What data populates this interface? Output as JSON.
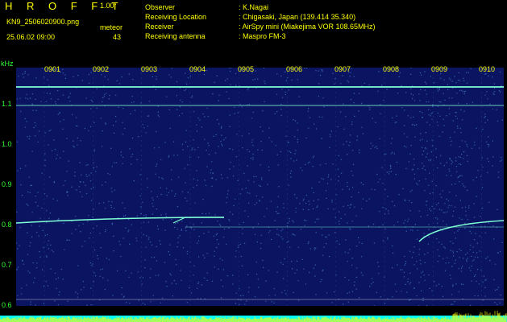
{
  "header": {
    "app_title": "H R O F F T",
    "version": "1.00f",
    "filename": "KN9_2506020900.png",
    "datetime": "25.06.02 09:00",
    "meteor_label": "meteor",
    "meteor_count": "43"
  },
  "info": [
    {
      "key": "Observer",
      "value": ": K.Nagai"
    },
    {
      "key": "Receiving Location",
      "value": ": Chigasaki, Japan (139.414 35.340)"
    },
    {
      "key": "Receiver",
      "value": ": AirSpy mini (Miakejima VOR 108.65MHz)"
    },
    {
      "key": "Receiving antenna",
      "value": ": Maspro FM-3"
    }
  ],
  "axis": {
    "unit": "kHz",
    "y_ticks": [
      "1.1",
      "1.0",
      "0.9",
      "0.8",
      "0.7",
      "0.6"
    ],
    "x_ticks": [
      "0901",
      "0902",
      "0903",
      "0904",
      "0905",
      "0906",
      "0907",
      "0908",
      "0909",
      "0910"
    ]
  },
  "colors": {
    "background": "#000000",
    "spectrogram": "#0a1460",
    "signal": "#7fffd4",
    "label_yellow": "#ffff00",
    "label_green": "#33ff33",
    "bar_cyan": "#00ffff",
    "bar_yellow": "#ffff00"
  }
}
